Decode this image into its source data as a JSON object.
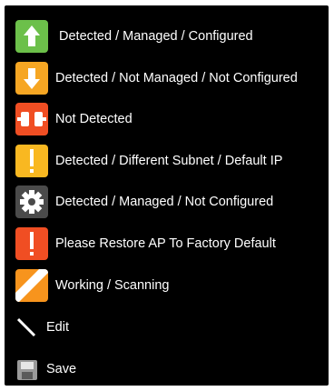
{
  "legend": {
    "items": [
      {
        "label": "Detected / Managed / Configured",
        "icon": "arrow-up-icon",
        "color": "#6cc04a"
      },
      {
        "label": "Detected / Not Managed / Not Configured",
        "icon": "arrow-down-icon",
        "color": "#f6a623"
      },
      {
        "label": "Not Detected",
        "icon": "disconnected-icon",
        "color": "#f04e23"
      },
      {
        "label": "Detected / Different Subnet / Default IP",
        "icon": "exclamation-icon",
        "color": "#f9b821"
      },
      {
        "label": "Detected / Managed / Not Configured",
        "icon": "gear-icon",
        "color": "#4a4a4a"
      },
      {
        "label": "Please Restore AP To Factory Default",
        "icon": "exclamation-icon",
        "color": "#f04e23"
      },
      {
        "label": "Working / Scanning",
        "icon": "scanning-stripes-icon",
        "color": "#f7941d"
      },
      {
        "label": "Edit",
        "icon": "pencil-icon",
        "color": "#ffffff"
      },
      {
        "label": "Save",
        "icon": "floppy-disk-icon",
        "color": "#9a9a9a"
      }
    ]
  }
}
